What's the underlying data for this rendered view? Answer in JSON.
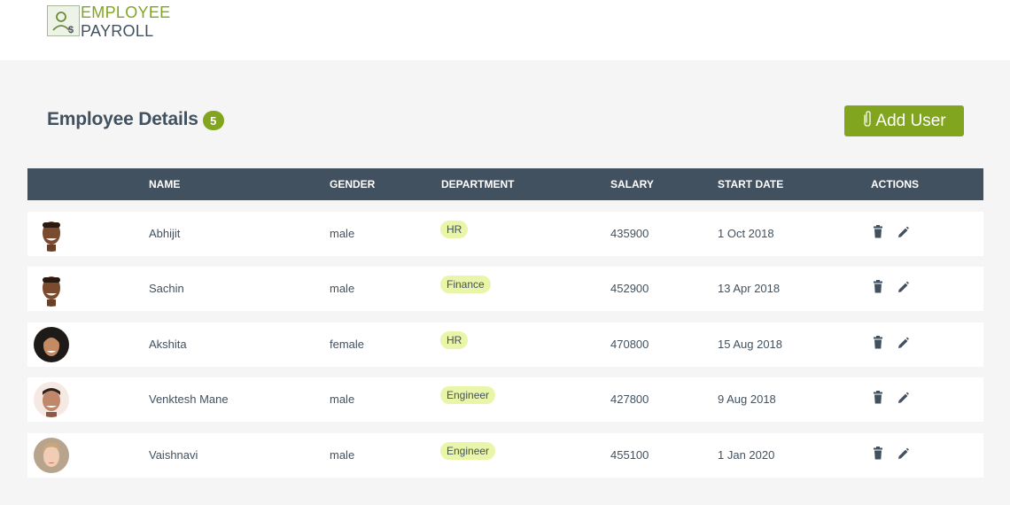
{
  "logo": {
    "line1": "EMPLOYEE",
    "line2": "PAYROLL",
    "icon": "user-dollar-icon"
  },
  "page": {
    "title": "Employee Details",
    "count": "5"
  },
  "add_button": {
    "label": "Add User",
    "icon": "paperclip-icon"
  },
  "table": {
    "headers": [
      "NAME",
      "GENDER",
      "DEPARTMENT",
      "SALARY",
      "START DATE",
      "ACTIONS"
    ],
    "rows": [
      {
        "name": "Abhijit",
        "gender": "male",
        "department": "HR",
        "salary": "435900",
        "start_date": "1 Oct 2018"
      },
      {
        "name": "Sachin",
        "gender": "male",
        "department": "Finance",
        "salary": "452900",
        "start_date": "13 Apr 2018"
      },
      {
        "name": "Akshita",
        "gender": "female",
        "department": "HR",
        "salary": "470800",
        "start_date": "15 Aug 2018"
      },
      {
        "name": "Venktesh Mane",
        "gender": "male",
        "department": "Engineer",
        "salary": "427800",
        "start_date": "9 Aug 2018"
      },
      {
        "name": "Vaishnavi",
        "gender": "male",
        "department": "Engineer",
        "salary": "455100",
        "start_date": "1 Jan 2020"
      }
    ],
    "action_icons": [
      "trash-icon",
      "pencil-icon"
    ]
  },
  "colors": {
    "accent": "#82a520",
    "header_bg": "#42515f",
    "badge_bg": "#e9f5a8",
    "page_bg": "#f5f5f5"
  }
}
